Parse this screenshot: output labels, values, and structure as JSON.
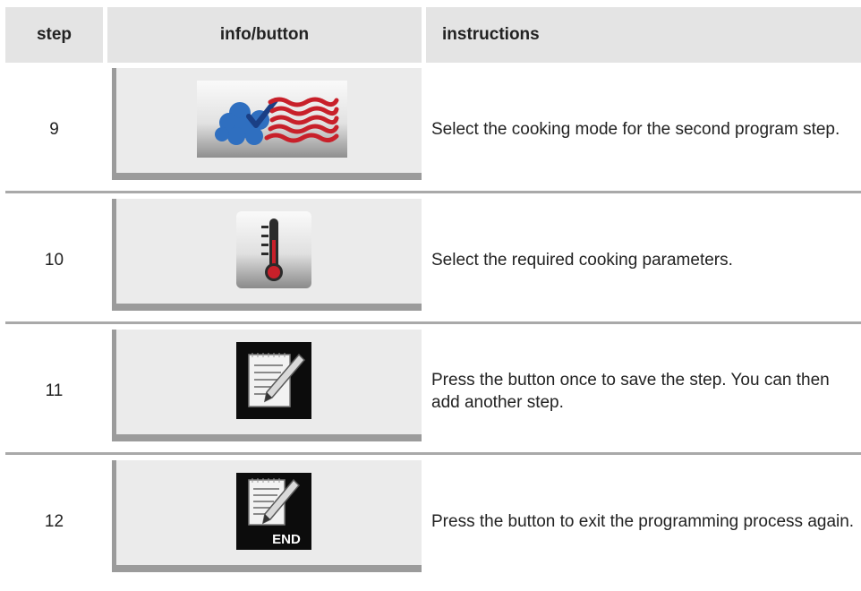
{
  "header": {
    "step": "step",
    "info": "info/button",
    "instructions": "instructions"
  },
  "rows": [
    {
      "step": "9",
      "icon": "cooking-mode-steam-hot-air-icon",
      "instruction": "Select the cooking mode for the second program step."
    },
    {
      "step": "10",
      "icon": "thermometer-icon",
      "instruction": "Select the required cooking parameters."
    },
    {
      "step": "11",
      "icon": "notepad-pen-icon",
      "instruction": "Press the button once to save the step. You can then add another step."
    },
    {
      "step": "12",
      "icon": "notepad-pen-end-icon",
      "button_text": "END",
      "instruction": "Press the button to exit the programming process again."
    }
  ],
  "colors": {
    "header_bg": "#e4e4e4",
    "panel_bg": "#ebebeb",
    "panel_border": "#9b9b9b",
    "divider": "#a9a9a9",
    "steam_blue": "#2f6fc0",
    "heat_red": "#c8202a"
  }
}
